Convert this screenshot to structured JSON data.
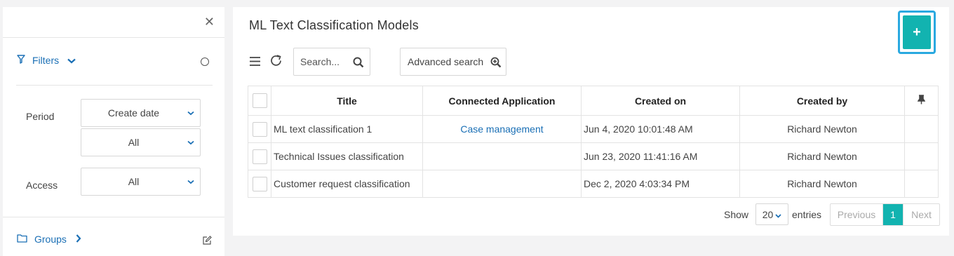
{
  "colors": {
    "accent": "#12b3b0",
    "link": "#1a6fb5",
    "highlight": "#2aa9e0"
  },
  "sidebar": {
    "close_icon": "close-icon",
    "filters_label": "Filters",
    "period_label": "Period",
    "period_select": "Create date",
    "period_range_select": "All",
    "access_label": "Access",
    "access_select": "All",
    "groups_label": "Groups"
  },
  "main": {
    "title": "ML Text Classification Models",
    "add_button": "+",
    "search_placeholder": "Search...",
    "advanced_search": "Advanced search",
    "columns": {
      "title": "Title",
      "app": "Connected Application",
      "created": "Created on",
      "by": "Created by"
    },
    "rows": [
      {
        "title": "ML text classification 1",
        "app": "Case management",
        "created": "Jun 4, 2020 10:01:48 AM",
        "by": "Richard Newton"
      },
      {
        "title": "Technical Issues classification",
        "app": "",
        "created": "Jun 23, 2020 11:41:16 AM",
        "by": "Richard Newton"
      },
      {
        "title": "Customer request classification",
        "app": "",
        "created": "Dec 2, 2020 4:03:34 PM",
        "by": "Richard Newton"
      }
    ],
    "footer": {
      "show": "Show",
      "page_size": "20",
      "entries": "entries",
      "previous": "Previous",
      "current_page": "1",
      "next": "Next"
    }
  }
}
